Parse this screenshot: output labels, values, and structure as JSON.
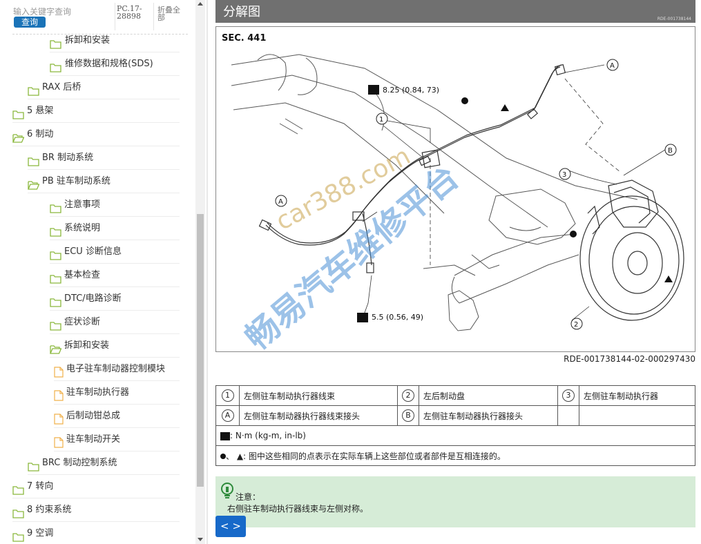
{
  "search": {
    "placeholder": "输入关键字查询",
    "button": "查询"
  },
  "doc_code": "PC.17-28898",
  "collapse_all": "折叠全部",
  "tree": [
    {
      "label": "拆卸和安装",
      "icon": "folder-icon"
    },
    {
      "label": "维修数据和规格(SDS)",
      "icon": "folder-icon"
    },
    {
      "label": "RAX 后桥",
      "icon": "folder-icon"
    },
    {
      "label": "5 悬架",
      "icon": "folder-icon"
    },
    {
      "label": "6 制动",
      "icon": "folder-open-icon"
    },
    {
      "label": "BR 制动系统",
      "icon": "folder-icon"
    },
    {
      "label": "PB 驻车制动系统",
      "icon": "folder-open-icon"
    },
    {
      "label": "注意事项",
      "icon": "folder-icon"
    },
    {
      "label": "系统说明",
      "icon": "folder-icon"
    },
    {
      "label": "ECU 诊断信息",
      "icon": "folder-icon"
    },
    {
      "label": "基本检查",
      "icon": "folder-icon"
    },
    {
      "label": "DTC/电路诊断",
      "icon": "folder-icon"
    },
    {
      "label": "症状诊断",
      "icon": "folder-icon"
    },
    {
      "label": "拆卸和安装",
      "icon": "folder-open-icon"
    },
    {
      "label": "电子驻车制动器控制模块",
      "icon": "document-icon"
    },
    {
      "label": "驻车制动执行器",
      "icon": "document-icon"
    },
    {
      "label": "后制动钳总成",
      "icon": "document-icon"
    },
    {
      "label": "驻车制动开关",
      "icon": "document-icon"
    },
    {
      "label": "BRC 制动控制系统",
      "icon": "folder-icon"
    },
    {
      "label": "7 转向",
      "icon": "folder-icon"
    },
    {
      "label": "8 约束系统",
      "icon": "folder-icon"
    },
    {
      "label": "9 空调",
      "icon": "folder-icon"
    }
  ],
  "header": {
    "title": "分解图",
    "code": "RDE-001738144"
  },
  "figure": {
    "sec": "SEC. 441",
    "torque_top": "8.25 (0.84, 73)",
    "torque_bottom": "5.5 (0.56, 49)",
    "callouts": [
      "1",
      "2",
      "3",
      "A",
      "B"
    ],
    "watermark_url": "car388.com",
    "watermark_text": "畅易汽车维修平台",
    "code": "RDE-001738144-02-000297430"
  },
  "legend": {
    "row1": [
      {
        "mark": "1",
        "text": "左侧驻车制动执行器线束"
      },
      {
        "mark": "2",
        "text": "左后制动盘"
      },
      {
        "mark": "3",
        "text": "左侧驻车制动执行器"
      }
    ],
    "row2": [
      {
        "mark": "A",
        "text": "左侧驻车制动器执行器线束接头"
      },
      {
        "mark": "B",
        "text": "左侧驻车制动器执行器接头"
      }
    ],
    "units": ": N·m (kg-m, in-lb)",
    "symbols_text": "、 ▲: 图中这些相同的点表示在实际车辆上这些部位或者部件是互相连接的。"
  },
  "note": {
    "title": "注意：",
    "text": "右侧驻车制动执行器线束与左侧对称。"
  },
  "nav": {
    "label": "< >"
  },
  "colors": {
    "header_bg": "#707070",
    "search_btn": "#1a73b8",
    "note_bg": "#d6ecd7",
    "nav_btn": "#1769c9",
    "folder": "#9bc24c",
    "document": "#f0b04a"
  }
}
